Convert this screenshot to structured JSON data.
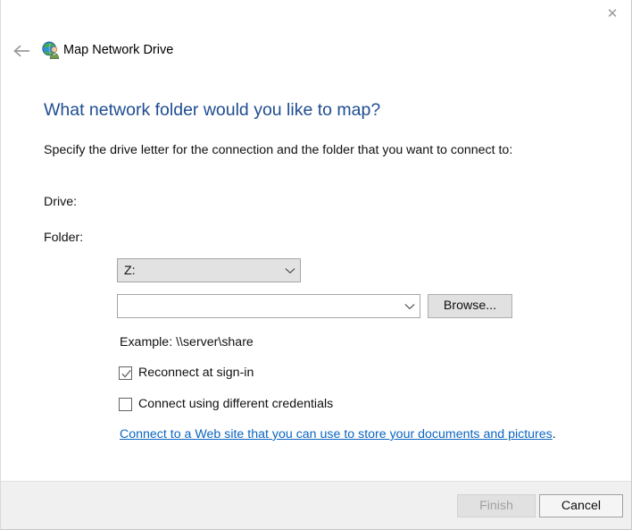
{
  "window": {
    "title": "Map Network Drive",
    "app_icon": "network-drive-globe-icon",
    "close_label": "✕",
    "back_label": "back-arrow"
  },
  "content": {
    "heading": "What network folder would you like to map?",
    "subheading": "Specify the drive letter for the connection and the folder that you want to connect to:",
    "drive_label": "Drive:",
    "drive_value": "Z:",
    "folder_label": "Folder:",
    "folder_value": "",
    "folder_placeholder": "",
    "browse_label": "Browse...",
    "example_text": "Example: \\\\server\\share",
    "reconnect_label": "Reconnect at sign-in",
    "reconnect_checked": true,
    "credentials_label": "Connect using different credentials",
    "credentials_checked": false,
    "weblink_text": "Connect to a Web site that you can use to store your documents and pictures",
    "weblink_suffix": "."
  },
  "footer": {
    "finish_label": "Finish",
    "finish_enabled": false,
    "cancel_label": "Cancel",
    "cancel_enabled": true
  },
  "colors": {
    "heading_blue": "#1f4d91",
    "link_blue": "#0B65C2",
    "footer_bg": "#f0f0f0",
    "disabled_text": "#a0a0a0",
    "combo_disabled_bg": "#e2e2e2"
  }
}
